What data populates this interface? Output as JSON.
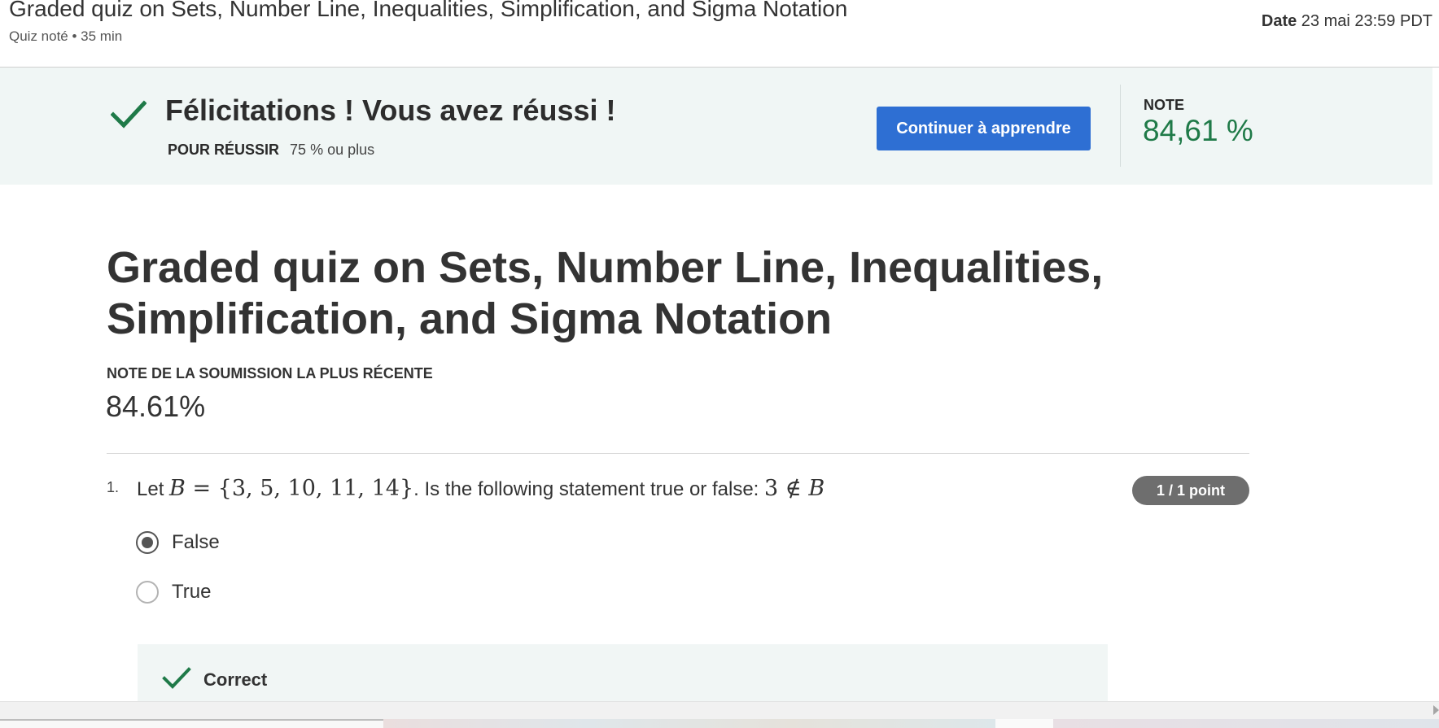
{
  "header": {
    "title": "Graded quiz on Sets, Number Line, Inequalities, Simplification, and Sigma Notation",
    "meta": "Quiz noté • 35 min",
    "date_label": "Date",
    "date_value": "23 mai 23:59 PDT"
  },
  "banner": {
    "title": "Félicitations ! Vous avez réussi !",
    "pass_label": "POUR RÉUSSIR",
    "pass_value": "75 % ou plus",
    "continue_label": "Continuer à apprendre",
    "grade_label": "NOTE",
    "grade_value": "84,61 %",
    "accent_color": "#1f7a48",
    "button_color": "#2e6fd3"
  },
  "main": {
    "title": "Graded quiz on Sets, Number Line, Inequalities, Simplification, and Sigma Notation",
    "recent_label": "NOTE DE LA SOUMISSION LA PLUS RÉCENTE",
    "recent_value": "84.61%"
  },
  "question": {
    "number": "1.",
    "text_before": "Let",
    "set_var": "B",
    "set_expr": " = {3, 5, 10, 11, 14}",
    "text_middle": ". Is the following statement true or false:",
    "statement_left": "3 ∉ ",
    "statement_var": "B",
    "points": "1 / 1 point",
    "options": [
      {
        "label": "False",
        "selected": true
      },
      {
        "label": "True",
        "selected": false
      }
    ],
    "feedback_label": "Correct",
    "feedback_icon": "checkmark-icon"
  }
}
